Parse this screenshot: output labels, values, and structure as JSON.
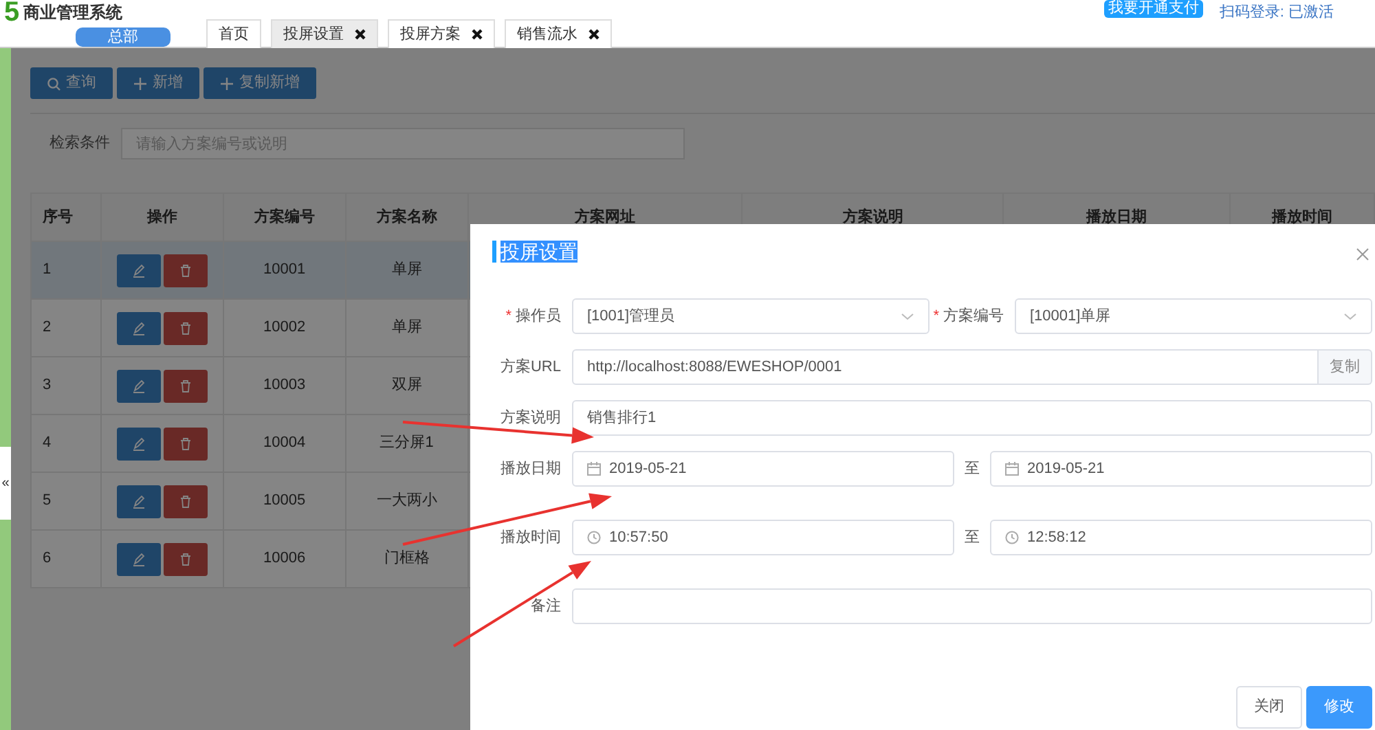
{
  "header": {
    "logo": "5",
    "app_title": "商业管理系统",
    "org_badge": "总部",
    "tabs": [
      {
        "label": "首页",
        "selected": false,
        "closable": false
      },
      {
        "label": "投屏设置",
        "selected": true,
        "closable": true
      },
      {
        "label": "投屏方案",
        "selected": false,
        "closable": true
      },
      {
        "label": "销售流水",
        "selected": false,
        "closable": true
      }
    ],
    "pay_badge": "我要开通支付",
    "login_status": "扫码登录: 已激活"
  },
  "sidebar_toggle": "«",
  "toolbar": [
    {
      "label": "查询",
      "kind": "search"
    },
    {
      "label": "新增",
      "kind": "add"
    },
    {
      "label": "复制新增",
      "kind": "add"
    }
  ],
  "search": {
    "label": "检索条件",
    "placeholder": "请输入方案编号或说明"
  },
  "table": {
    "columns": [
      "序号",
      "操作",
      "方案编号",
      "方案名称",
      "方案网址",
      "方案说明",
      "播放日期",
      "播放时间"
    ],
    "rows": [
      {
        "number": "1",
        "code": "10001",
        "name": "单屏",
        "selected": true
      },
      {
        "number": "2",
        "code": "10002",
        "name": "单屏",
        "selected": false
      },
      {
        "number": "3",
        "code": "10003",
        "name": "双屏",
        "selected": false
      },
      {
        "number": "4",
        "code": "10004",
        "name": "三分屏1",
        "selected": false
      },
      {
        "number": "5",
        "code": "10005",
        "name": "一大两小",
        "selected": false
      },
      {
        "number": "6",
        "code": "10006",
        "name": "门框格",
        "selected": false
      }
    ]
  },
  "dialog": {
    "title": "投屏设置",
    "rows": [
      {
        "kind": "select_pair",
        "fields": [
          {
            "mark": "*",
            "label": "操作员",
            "value": "[1001]管理员"
          },
          {
            "mark": "*",
            "label": "方案编号",
            "value": "[10001]单屏"
          }
        ]
      },
      {
        "kind": "addon",
        "label": "方案URL",
        "value": "http://localhost:8088/EWESHOP/0001",
        "addon": "复制"
      },
      {
        "kind": "text",
        "label": "方案说明",
        "value": "销售排行1"
      },
      {
        "kind": "date_range",
        "label": "播放日期",
        "from": "2019-05-21",
        "separator": "至",
        "to": "2019-05-21"
      },
      {
        "kind": "time_range",
        "label": "播放时间",
        "from": "10:57:50",
        "separator": "至",
        "to": "12:58:12"
      },
      {
        "kind": "text",
        "label": "备注"
      }
    ],
    "buttons": [
      {
        "label": "关闭",
        "primary": false
      },
      {
        "label": "修改",
        "primary": true
      }
    ]
  }
}
